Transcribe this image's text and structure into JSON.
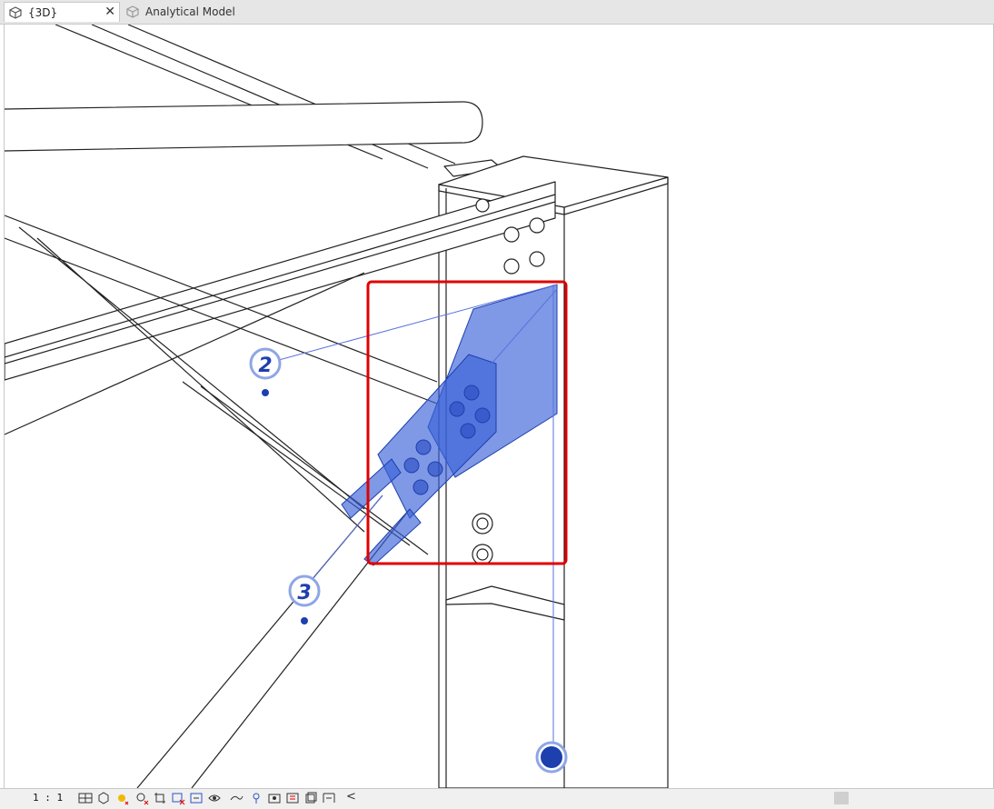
{
  "tabs": [
    {
      "label": "{3D}",
      "active": true,
      "icon": "3d-view-icon"
    },
    {
      "label": "Analytical Model",
      "active": false,
      "icon": "3d-view-icon"
    }
  ],
  "tab_close_glyph": "✕",
  "viewport": {
    "markers": [
      {
        "label": "2"
      },
      {
        "label": "3"
      }
    ],
    "selection_color": "#3a62d8",
    "highlight_color": "#e00000"
  },
  "status": {
    "scale": "1 : 1",
    "chevron": "<",
    "icons": [
      "detail-level-icon",
      "visual-style-icon",
      "sun-path-icon",
      "shadows-icon",
      "crop-view-icon",
      "show-crop-icon",
      "temporary-hide-icon",
      "reveal-hidden-icon",
      "lock-3d-icon",
      "analytical-model-icon",
      "highlight-displacement-icon",
      "reveal-constraints-icon",
      "workset-icon",
      "design-options-icon",
      "worksharing-display-icon",
      "temporary-view-properties-icon",
      "hide-analytical-icon"
    ]
  }
}
